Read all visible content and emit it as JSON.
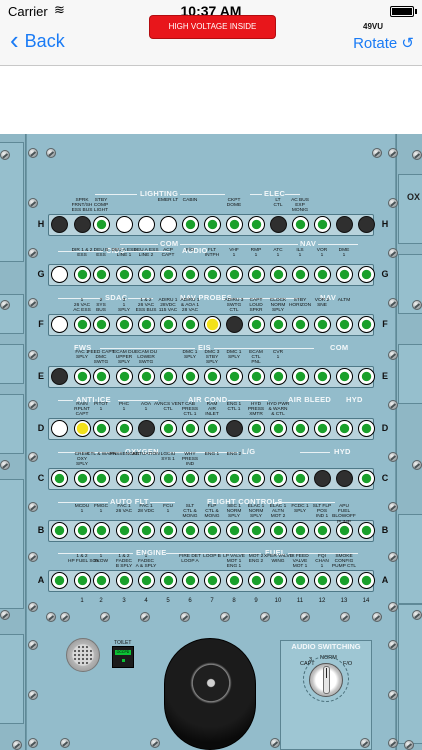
{
  "status_bar": {
    "carrier": "Carrier",
    "time": "10:37 AM"
  },
  "nav": {
    "back_label": "Back",
    "rotate_label": "Rotate ↺"
  },
  "panel": {
    "warning": "HIGH VOLTAGE INSIDE",
    "id": "49VU",
    "right_side_label": "OX",
    "rows": [
      {
        "letter": "H",
        "states": [
          "off",
          "off",
          "on",
          "light",
          "light",
          "light",
          "on",
          "on",
          "on",
          "on",
          "off",
          "on",
          "on",
          "off",
          "off",
          "off"
        ]
      },
      {
        "letter": "G",
        "states": [
          "light",
          "on",
          "on",
          "on",
          "on",
          "on",
          "on",
          "on",
          "on",
          "on",
          "on",
          "on",
          "on",
          "on",
          "on",
          "on"
        ]
      },
      {
        "letter": "F",
        "states": [
          "light",
          "on",
          "on",
          "on",
          "on",
          "on",
          "on",
          "yellow",
          "off",
          "on",
          "on",
          "on",
          "on",
          "on",
          "on",
          "on"
        ]
      },
      {
        "letter": "E",
        "states": [
          "off",
          "on",
          "on",
          "on",
          "on",
          "on",
          "on",
          "on",
          "on",
          "on",
          "on",
          "on",
          "on",
          "on",
          "on",
          "on"
        ]
      },
      {
        "letter": "D",
        "states": [
          "light",
          "yellow",
          "on",
          "on",
          "off",
          "on",
          "on",
          "on",
          "off",
          "on",
          "on",
          "on",
          "on",
          "on",
          "on",
          "on"
        ]
      },
      {
        "letter": "C",
        "states": [
          "on",
          "on",
          "on",
          "on",
          "on",
          "on",
          "on",
          "on",
          "on",
          "on",
          "on",
          "on",
          "off",
          "off",
          "on",
          "on"
        ]
      },
      {
        "letter": "B",
        "states": [
          "on",
          "on",
          "on",
          "on",
          "on",
          "on",
          "on",
          "on",
          "on",
          "on",
          "on",
          "on",
          "on",
          "on",
          "on",
          "on"
        ]
      },
      {
        "letter": "A",
        "states": [
          "on",
          "on",
          "on",
          "on",
          "on",
          "on",
          "on",
          "on",
          "on",
          "on",
          "on",
          "on",
          "on",
          "on",
          "on",
          "on"
        ]
      }
    ],
    "col_numbers": [
      "1",
      "2",
      "3",
      "4",
      "5",
      "6",
      "7",
      "8",
      "9",
      "10",
      "11",
      "12",
      "13",
      "14"
    ]
  },
  "groups": {
    "lighting": "LIGHTING",
    "elec": "ELEC",
    "cids": "CIDS",
    "com1": "COM",
    "audio": "AUDIO",
    "nav1": "NAV",
    "sdac": "SDAC",
    "nav_probes": "NAV PROBES",
    "nav2": "NAV",
    "fws": "FWS",
    "eis": "EIS",
    "com2": "COM",
    "anti_ice": "ANTI-ICE",
    "air_cond": "AIR COND",
    "air_bleed": "AIR BLEED",
    "hyd1": "HYD",
    "oxygen": "OXYGEN",
    "ls": "L/G",
    "hyd2": "HYD",
    "auto_flt": "AUTO FLT",
    "flight_controls": "FLIGHT CONTROLS",
    "engine": "ENGINE",
    "fuel": "FUEL"
  },
  "sublabels": {
    "h": [
      "SPRK\nFRNT/SH\nESS BUS",
      "STBY\nCOMP\nLIGHT",
      "",
      "",
      "EMER LT",
      "CABIN",
      "",
      "CKPT\nDOME",
      "",
      "LT\nCTL",
      "AC BUS\nEXP\nMONIG"
    ],
    "g": [
      "DIR 1 & 2\nESS",
      "DEU B\nESS",
      "DEU A ESS\nLINE 1",
      "DEU A ESS\nLINE 2",
      "ACP\nCAPT",
      "F/O",
      "FLT\nINTPH",
      "VHF\n1",
      "RMP\n1",
      "ATC\n1",
      "ILS\n1",
      "VOR\n1",
      "DME\n1"
    ],
    "f": [
      "1\n26 VAC\nAC ESS",
      "2\nSYS\nBUS",
      "3\n1\nSPLY",
      "1 & 2\n26 VAC\nESS BUS",
      "ADIRU 1\n28VDC\n115 VAC",
      "ADIRU 1\n& AOA 1\n28 VAC",
      "",
      "ADIRU 3\nSWTG\nCTL",
      "CAPT\nLOUD\nSPKR",
      "CLOCK\nNORM\nSPLY",
      "STBY\nHORIZON",
      "VOR 2\nSNE",
      "ALTM"
    ],
    "e": [
      "FAC 1\nSPLY",
      "FEED CAPT\nDMC\nSWTG",
      "ECAM DU\nUPPER\nSPLY",
      "ECAM DU\nLOWER\nSWTG",
      "",
      "DMC 1\nSPLY",
      "DMC 3\nSTBY\nSPLY",
      "DMC 1\nSPLY",
      "ECAM\nCTL\nPNL",
      "CVR\n1"
    ],
    "d": [
      "RAIN\nRPLNT\nCAPT",
      "PITOT\n1",
      "PHC\n1",
      "AOA\n1",
      "AVNCS VENT\nCTL",
      "CAB\nPRESS\nCTL 1",
      "RAM\nAIR\nINLET",
      "ENG 1\nCTL 1",
      "HYD\nPRESS\nXMTR",
      "HYD PWR\n& WARN\n& CTL"
    ],
    "c": [
      "CREW\nOXY\nSPLY",
      "CTL & WARN",
      "PASSENGER",
      "ACTUATION",
      "LGCIU\nSYS 1",
      "WHY\nPRESS\nIND",
      "ENG 1",
      "ENG 2"
    ],
    "b": [
      "MCDU\n1",
      "FMGC\n1",
      "FAC 1\n26 VAC",
      "FAC 1\n28 VDC",
      "FCU\n1",
      "SLT\nCTL &\nMONG",
      "FLP\nCTL &\nMONG",
      "SEC 1\nNORM\nSPLY",
      "ELAC 1\nNORM\nSPLY",
      "ELAC 1\nALTN\nMOT 2",
      "FCDC 1\nSPLY",
      "SLT FLP\nPOS\nIND 1",
      "APU\nFUEL\nBLOWOFF\nPUMP"
    ],
    "a": [
      "1 & 2\nHP FUEL SOV",
      "1\nSLOW",
      "1 & 2\nFADEC\nB SPLY",
      "1\nFADEC\nA & SPLY",
      "",
      "FIRE DET\nLOOP A",
      "LOOP B",
      "LP VALVE\nMOT 1\nENG 1",
      "MOT 2\nENG 2",
      "XFER VALVE\nWING",
      "X FEED\nVALVE\nMOT 1",
      "FQI\nCHAN\n1",
      "SMOKE\nCONFIG\nPUMP CTL"
    ]
  },
  "bottom": {
    "toilet_label": "TOILET",
    "toilet_sign": "OCCPD",
    "audio_title": "AUDIO SWITCHING",
    "audio_norm": "NORM",
    "audio_capt": "CAPT",
    "audio_fo": "F/O",
    "audio_3": "3"
  }
}
